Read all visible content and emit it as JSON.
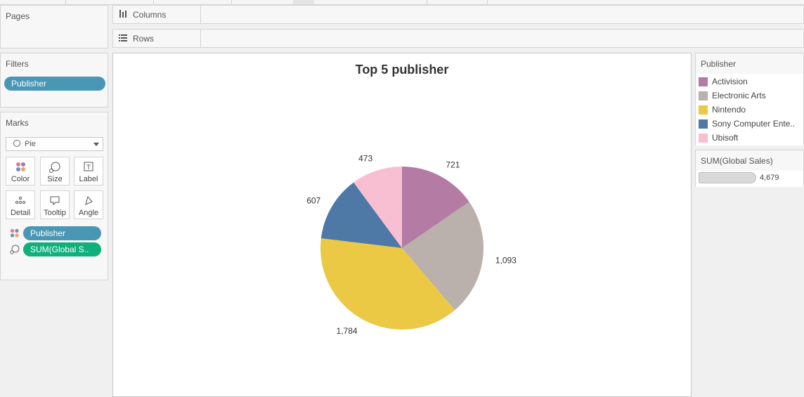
{
  "panels": {
    "pages": {
      "title": "Pages"
    },
    "filters": {
      "title": "Filters",
      "pill": "Publisher"
    },
    "marks": {
      "title": "Marks",
      "mark_type": "Pie",
      "buttons": {
        "color": "Color",
        "size": "Size",
        "label": "Label",
        "detail": "Detail",
        "tooltip": "Tooltip",
        "angle": "Angle"
      },
      "fields": [
        {
          "label": "Publisher",
          "icon": "color-dots-icon"
        },
        {
          "label": "SUM(Global S..",
          "icon": "size-icon"
        }
      ]
    }
  },
  "shelves": {
    "columns": {
      "label": "Columns",
      "icon": "columns-icon"
    },
    "rows": {
      "label": "Rows",
      "icon": "rows-icon"
    }
  },
  "legend": {
    "title": "Publisher",
    "items": [
      {
        "label": "Activision",
        "color": "#b47ba4"
      },
      {
        "label": "Electronic Arts",
        "color": "#bab0ac"
      },
      {
        "label": "Nintendo",
        "color": "#ebc944"
      },
      {
        "label": "Sony Computer Ente..",
        "color": "#4e79a7"
      },
      {
        "label": "Ubisoft",
        "color": "#f8bfd2"
      }
    ]
  },
  "size_legend": {
    "title": "SUM(Global Sales)",
    "value": "4,679"
  },
  "chart_data": {
    "type": "pie",
    "title": "Top 5 publisher",
    "slices": [
      {
        "label": "Activision",
        "value": 721,
        "display": "721",
        "color": "#b47ba4"
      },
      {
        "label": "Electronic Arts",
        "value": 1093,
        "display": "1,093",
        "color": "#bab0ac"
      },
      {
        "label": "Nintendo",
        "value": 1784,
        "display": "1,784",
        "color": "#ebc944"
      },
      {
        "label": "Sony Computer Entertainment",
        "value": 607,
        "display": "607",
        "color": "#4e79a7"
      },
      {
        "label": "Ubisoft",
        "value": 473,
        "display": "473",
        "color": "#f8bfd2"
      }
    ]
  }
}
